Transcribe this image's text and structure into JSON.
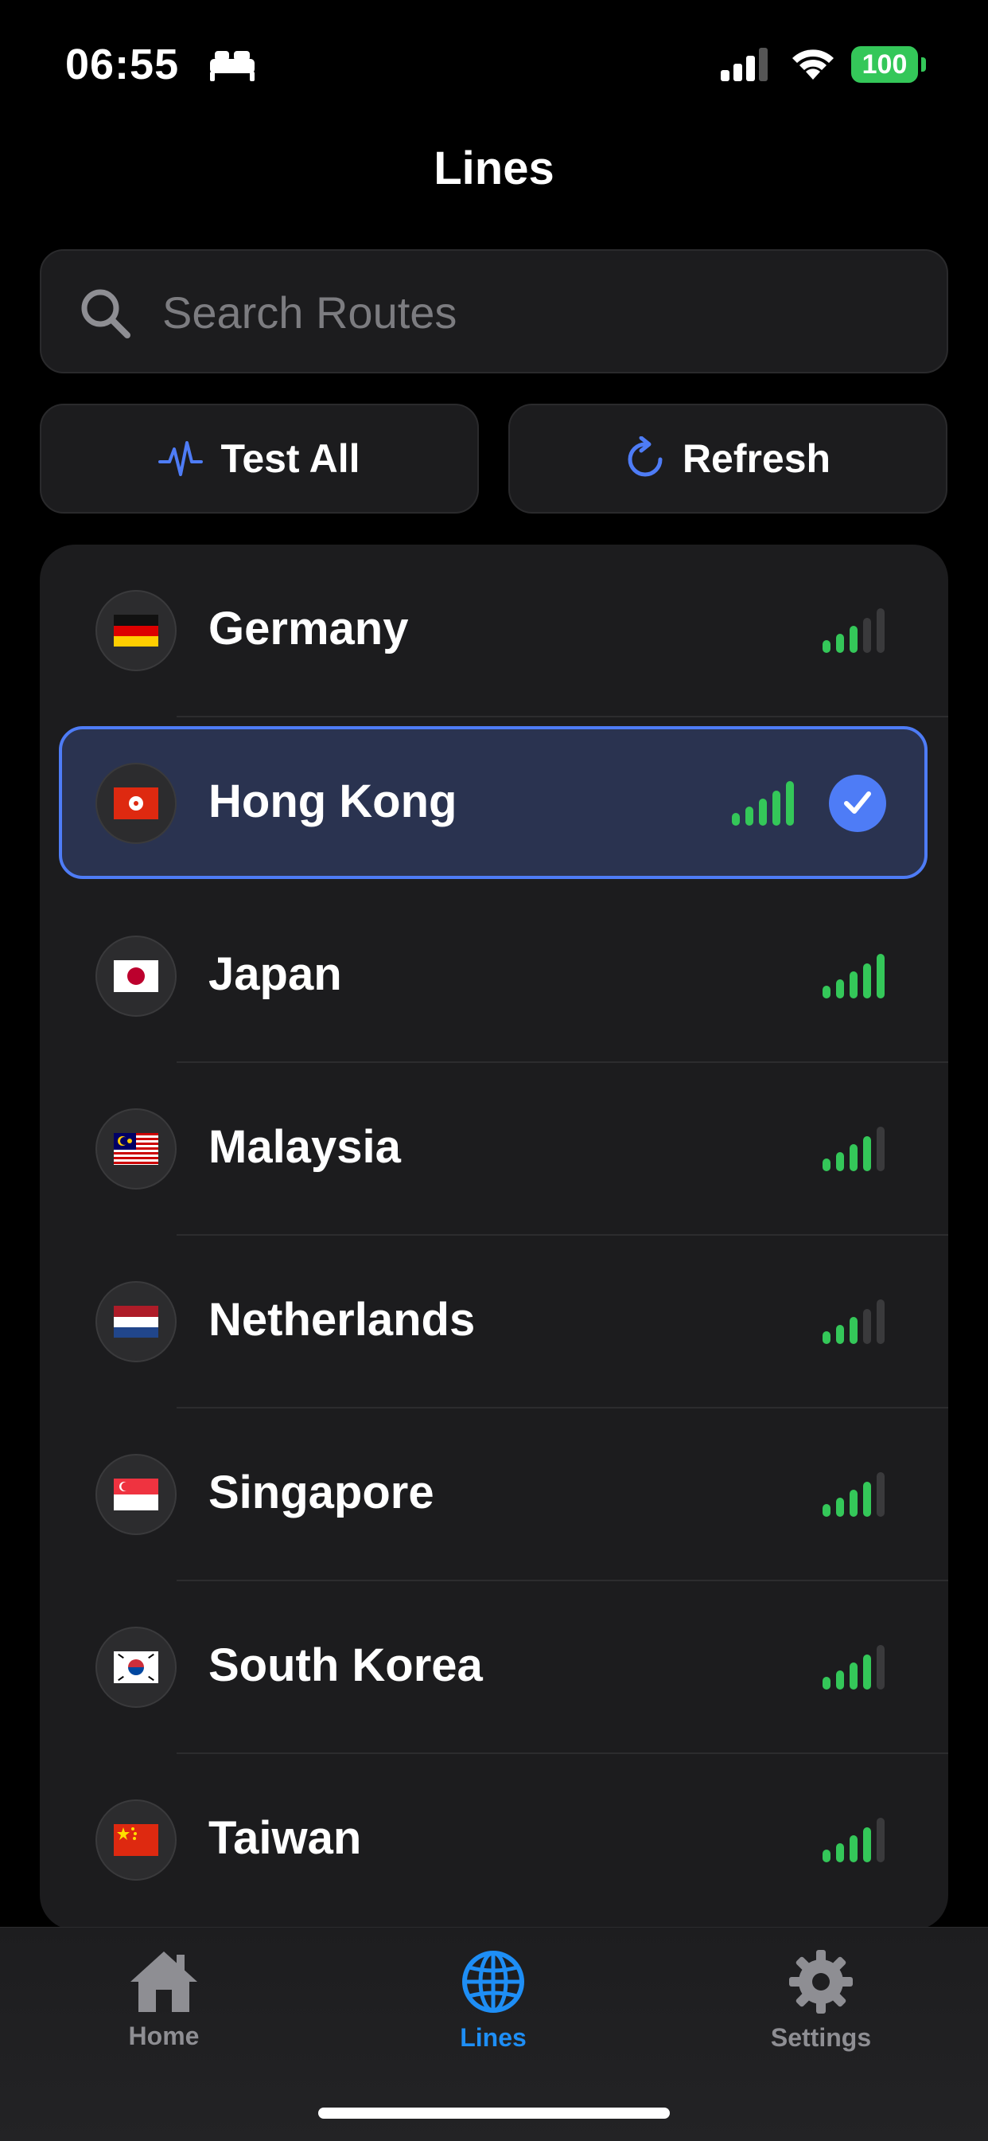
{
  "status_bar": {
    "time": "06:55",
    "battery": "100",
    "icons": [
      "sleep-focus-icon",
      "cellular-signal-icon",
      "wifi-icon",
      "battery-icon"
    ]
  },
  "nav": {
    "title": "Lines"
  },
  "search": {
    "placeholder": "Search Routes",
    "value": ""
  },
  "actions": {
    "test_all_label": "Test All",
    "test_all_icon": "waveform-icon",
    "refresh_label": "Refresh",
    "refresh_icon": "refresh-icon"
  },
  "routes": [
    {
      "country": "Germany",
      "flag": "germany-flag-icon",
      "signal_bars": 3,
      "selected": false
    },
    {
      "country": "Hong Kong",
      "flag": "hong-kong-flag-icon",
      "signal_bars": 5,
      "selected": true
    },
    {
      "country": "Japan",
      "flag": "japan-flag-icon",
      "signal_bars": 5,
      "selected": false
    },
    {
      "country": "Malaysia",
      "flag": "malaysia-flag-icon",
      "signal_bars": 4,
      "selected": false
    },
    {
      "country": "Netherlands",
      "flag": "netherlands-flag-icon",
      "signal_bars": 3,
      "selected": false
    },
    {
      "country": "Singapore",
      "flag": "singapore-flag-icon",
      "signal_bars": 4,
      "selected": false
    },
    {
      "country": "South Korea",
      "flag": "south-korea-flag-icon",
      "signal_bars": 4,
      "selected": false
    },
    {
      "country": "Taiwan",
      "flag": "taiwan-flag-icon",
      "signal_bars": 4,
      "selected": false
    }
  ],
  "tabs": [
    {
      "label": "Home",
      "icon": "house-icon",
      "active": false
    },
    {
      "label": "Lines",
      "icon": "globe-icon",
      "active": true
    },
    {
      "label": "Settings",
      "icon": "gear-icon",
      "active": false
    }
  ],
  "colors": {
    "accent": "#4e7cf6",
    "tab_active": "#1e8ef5",
    "signal_green": "#34c759",
    "background": "#000000",
    "card": "#1c1c1e"
  }
}
